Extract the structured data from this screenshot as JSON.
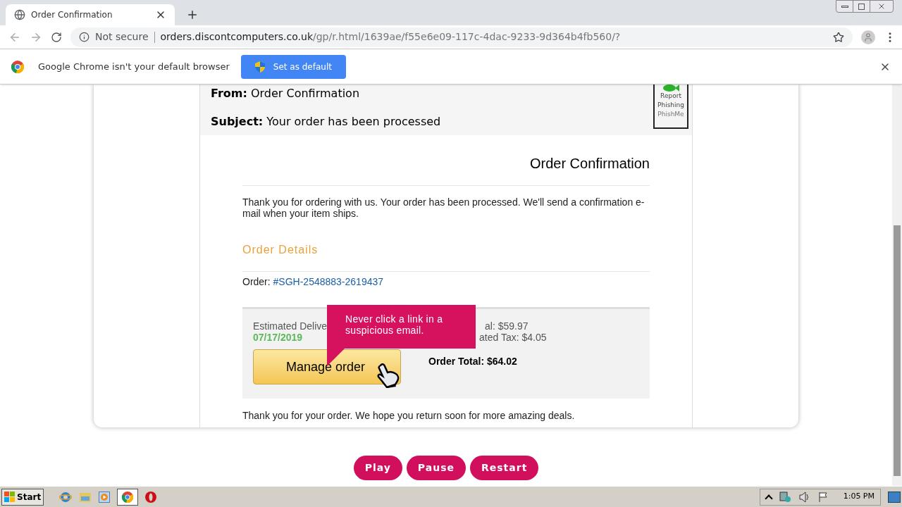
{
  "browser": {
    "tab": {
      "title": "Order Confirmation",
      "selected": true
    },
    "address": {
      "security": "Not secure",
      "host": "orders.discontcomputers.co.uk",
      "path": "/gp/r.html/1639ae/f55e6e09-117c-4dac-9233-9d364b4fb560/?"
    },
    "infobar": {
      "message": "Google Chrome isn't your default browser",
      "button": "Set as default"
    }
  },
  "email": {
    "from_label": "From:",
    "from": "Order Confirmation",
    "subject_label": "Subject:",
    "subject": "Your order has been processed",
    "report": [
      "Report",
      "Phishing",
      "PhishMe"
    ],
    "title": "Order Confirmation",
    "intro": "Thank you for ordering with us. Your order has been processed. We'll send a confirmation e-mail when your item ships.",
    "details_heading": "Order Details",
    "order_label": "Order:",
    "order_number": "#SGH-2548883-2619437",
    "delivery_label": "Estimated Delive",
    "delivery_date": "07/17/2019",
    "subtotal": "al: $59.97",
    "tax": "ated Tax: $4.05",
    "total": "Order Total: $64.02",
    "button": "Manage order",
    "tooltip": "Never click a link in a suspicious email.",
    "closing": "Thank you for your order. We hope you return soon for more amazing deals."
  },
  "controls": [
    "Play",
    "Pause",
    "Restart"
  ],
  "taskbar": {
    "start": "Start",
    "clock": "1:05 PM"
  }
}
